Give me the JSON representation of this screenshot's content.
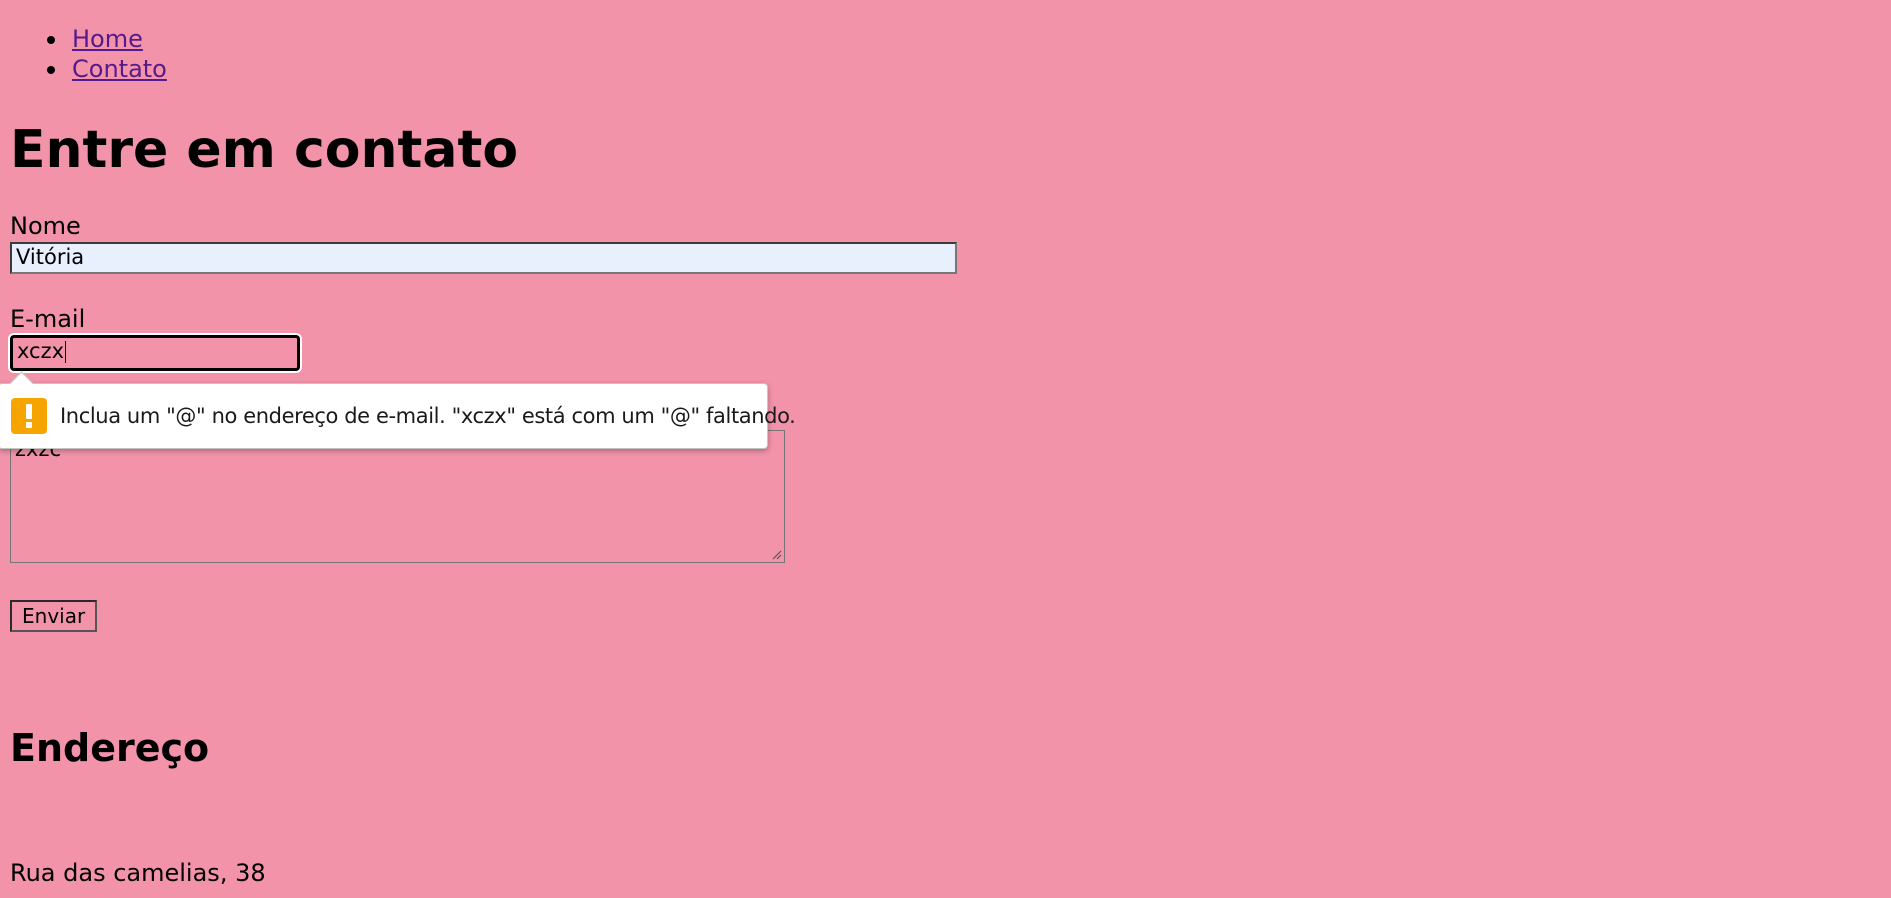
{
  "nav": {
    "items": [
      {
        "label": "Home"
      },
      {
        "label": "Contato"
      }
    ]
  },
  "contact": {
    "title": "Entre em contato",
    "name_label": "Nome",
    "name_value": "Vitória",
    "email_label": "E-mail",
    "email_value": "xczx",
    "message_value": "zxzc",
    "submit_label": "Enviar"
  },
  "validation_tooltip": {
    "message": "Inclua um \"@\" no endereço de e-mail. \"xczx\" está com um \"@\" faltando.",
    "icon": "warning-icon",
    "icon_color": "#f6a500"
  },
  "address": {
    "title": "Endereço",
    "line": "Rua das camelias, 38"
  },
  "colors": {
    "background": "#f393aa",
    "link": "#551a8b",
    "autofill": "#e8f0fe"
  }
}
